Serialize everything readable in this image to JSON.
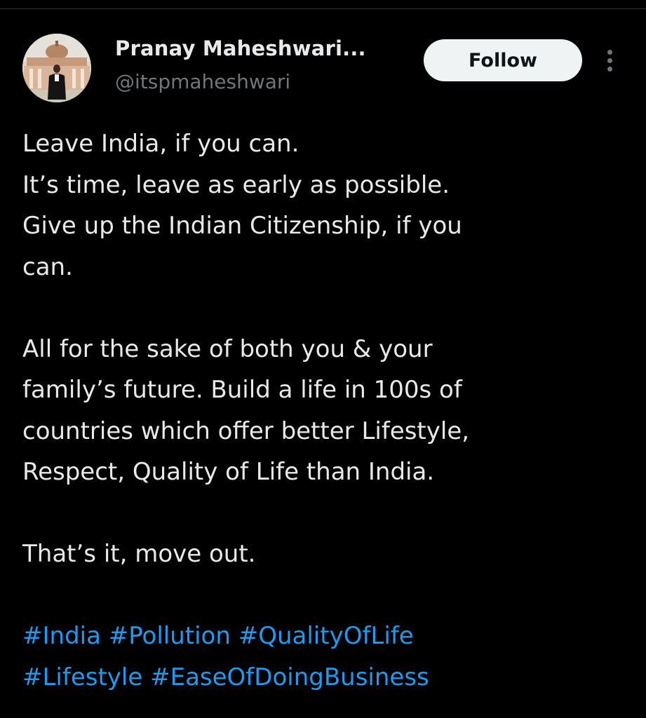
{
  "author": {
    "display_name": "Pranay Maheshwari...",
    "handle": "@itspmaheshwari"
  },
  "actions": {
    "follow_label": "Follow"
  },
  "tweet": {
    "paragraphs": [
      [
        "Leave India, if you can.",
        "It’s time, leave as early as possible.",
        "Give up the Indian Citizenship, if you",
        "can."
      ],
      [
        "All for the sake of both you & your",
        "family’s future. Build a life in 100s of",
        "countries which offer better Lifestyle,",
        "Respect, Quality of Life than India."
      ],
      [
        "That’s it, move out."
      ]
    ],
    "hashtags": [
      [
        "#India",
        "#Pollution",
        "#QualityOfLife"
      ],
      [
        "#Lifestyle",
        "#EaseOfDoingBusiness"
      ]
    ]
  },
  "colors": {
    "background": "#000000",
    "text": "#e7e9ea",
    "muted": "#71767b",
    "link": "#1d9bf0",
    "follow_bg": "#eff3f4"
  },
  "icons": {
    "more": "more-vertical-icon"
  }
}
